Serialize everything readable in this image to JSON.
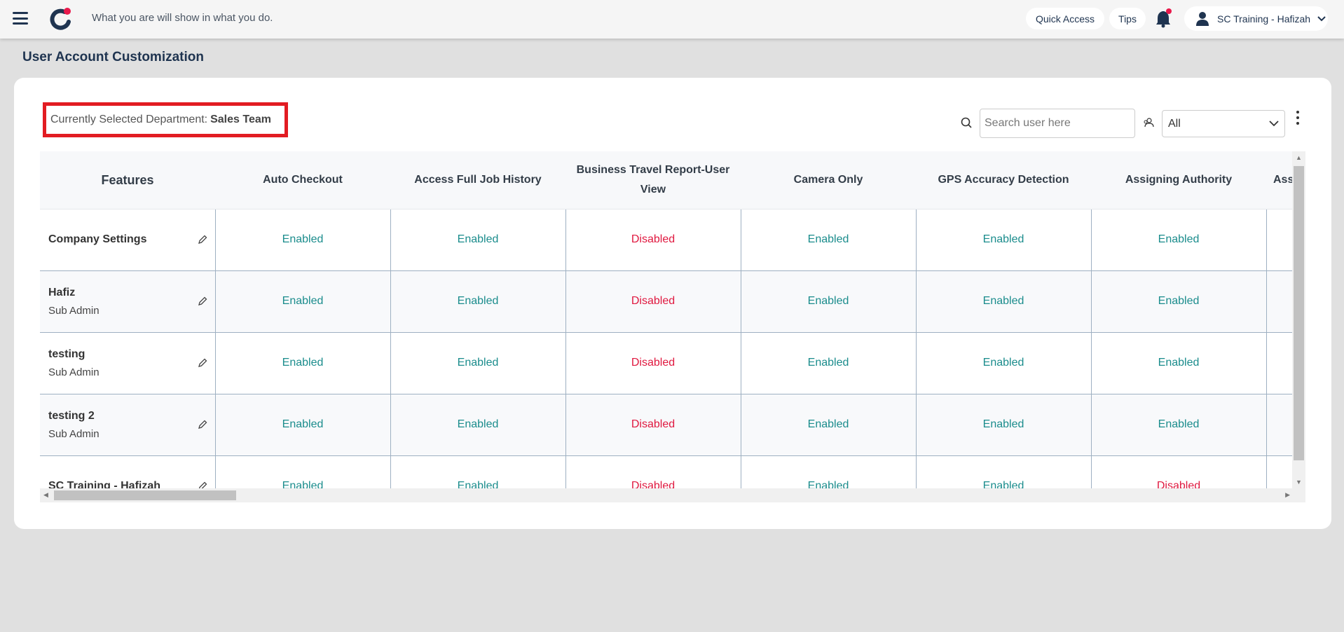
{
  "header": {
    "motto": "What you are will show in what you do.",
    "quick_access": "Quick Access",
    "tips": "Tips",
    "user": "SC Training - Hafizah",
    "colors": {
      "brand": "#1f3450",
      "accent": "#e8194b"
    }
  },
  "page": {
    "title": "User Account Customization"
  },
  "department": {
    "label": "Currently Selected Department:",
    "value": "Sales Team"
  },
  "filters": {
    "search_placeholder": "Search user here",
    "role_select": "All"
  },
  "table": {
    "columns": [
      "Features",
      "Auto Checkout",
      "Access Full Job History",
      "Business Travel Report-User View",
      "Camera Only",
      "GPS Accuracy Detection",
      "Assigning Authority",
      "Ass"
    ],
    "rows": [
      {
        "name": "Company Settings",
        "role": "",
        "values": [
          "Enabled",
          "Enabled",
          "Disabled",
          "Enabled",
          "Enabled",
          "Enabled",
          ""
        ]
      },
      {
        "name": "Hafiz",
        "role": "Sub Admin",
        "values": [
          "Enabled",
          "Enabled",
          "Disabled",
          "Enabled",
          "Enabled",
          "Enabled",
          ""
        ]
      },
      {
        "name": "testing",
        "role": "Sub Admin",
        "values": [
          "Enabled",
          "Enabled",
          "Disabled",
          "Enabled",
          "Enabled",
          "Enabled",
          ""
        ]
      },
      {
        "name": "testing 2",
        "role": "Sub Admin",
        "values": [
          "Enabled",
          "Enabled",
          "Disabled",
          "Enabled",
          "Enabled",
          "Enabled",
          ""
        ]
      },
      {
        "name": "SC Training - Hafizah",
        "role": "",
        "values": [
          "Enabled",
          "Enabled",
          "Disabled",
          "Enabled",
          "Enabled",
          "Disabled",
          ""
        ]
      }
    ],
    "status_colors": {
      "Enabled": "#1a8c8c",
      "Disabled": "#e0183f"
    }
  }
}
